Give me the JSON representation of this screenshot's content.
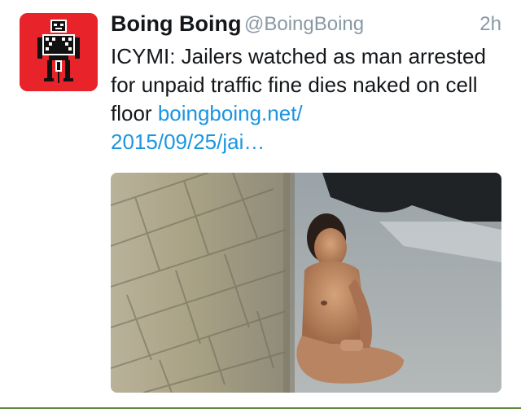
{
  "tweet": {
    "author_name": "Boing Boing",
    "author_handle": "@BoingBoing",
    "timestamp": "2h",
    "text": "ICYMI: Jailers watched as man arrested for unpaid traffic fine dies naked on cell floor ",
    "link_line1": "boingboing.net/",
    "link_line2": "2015/09/25/jai…",
    "avatar_icon": "boingboing-logo-icon",
    "media_icon": "photo-image"
  },
  "colors": {
    "avatar_bg": "#e8232a",
    "link": "#1b95e0",
    "secondary_text": "#8899a6",
    "divider": "#5a8a3a"
  }
}
